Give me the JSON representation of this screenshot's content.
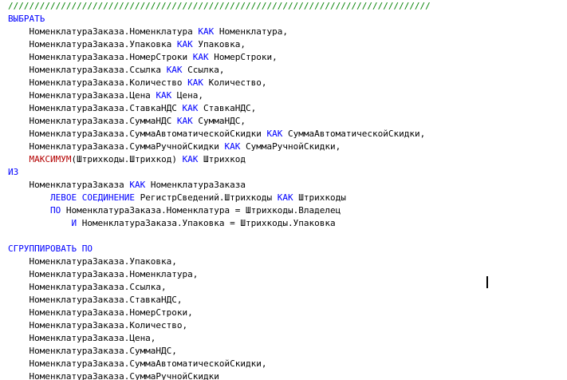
{
  "editor": {
    "colors": {
      "comment": "#008000",
      "keyword": "#0000ff",
      "function": "#b40000",
      "text": "#000000",
      "background": "#ffffff"
    },
    "lines": [
      [
        {
          "t": "////////////////////////////////////////////////////////////////////////////////",
          "c": "cm"
        }
      ],
      [
        {
          "t": "ВЫБРАТЬ",
          "c": "kw"
        }
      ],
      [
        {
          "t": "    НоменклатураЗаказа.Номенклатура ",
          "c": "id"
        },
        {
          "t": "КАК",
          "c": "kw"
        },
        {
          "t": " Номенклатура,",
          "c": "id"
        }
      ],
      [
        {
          "t": "    НоменклатураЗаказа.Упаковка ",
          "c": "id"
        },
        {
          "t": "КАК",
          "c": "kw"
        },
        {
          "t": " Упаковка,",
          "c": "id"
        }
      ],
      [
        {
          "t": "    НоменклатураЗаказа.НомерСтроки ",
          "c": "id"
        },
        {
          "t": "КАК",
          "c": "kw"
        },
        {
          "t": " НомерСтроки,",
          "c": "id"
        }
      ],
      [
        {
          "t": "    НоменклатураЗаказа.Ссылка ",
          "c": "id"
        },
        {
          "t": "КАК",
          "c": "kw"
        },
        {
          "t": " Ссылка,",
          "c": "id"
        }
      ],
      [
        {
          "t": "    НоменклатураЗаказа.Количество ",
          "c": "id"
        },
        {
          "t": "КАК",
          "c": "kw"
        },
        {
          "t": " Количество,",
          "c": "id"
        }
      ],
      [
        {
          "t": "    НоменклатураЗаказа.Цена ",
          "c": "id"
        },
        {
          "t": "КАК",
          "c": "kw"
        },
        {
          "t": " Цена,",
          "c": "id"
        }
      ],
      [
        {
          "t": "    НоменклатураЗаказа.СтавкаНДС ",
          "c": "id"
        },
        {
          "t": "КАК",
          "c": "kw"
        },
        {
          "t": " СтавкаНДС,",
          "c": "id"
        }
      ],
      [
        {
          "t": "    НоменклатураЗаказа.СуммаНДС ",
          "c": "id"
        },
        {
          "t": "КАК",
          "c": "kw"
        },
        {
          "t": " СуммаНДС,",
          "c": "id"
        }
      ],
      [
        {
          "t": "    НоменклатураЗаказа.СуммаАвтоматическойСкидки ",
          "c": "id"
        },
        {
          "t": "КАК",
          "c": "kw"
        },
        {
          "t": " СуммаАвтоматическойСкидки,",
          "c": "id"
        }
      ],
      [
        {
          "t": "    НоменклатураЗаказа.СуммаРучнойСкидки ",
          "c": "id"
        },
        {
          "t": "КАК",
          "c": "kw"
        },
        {
          "t": " СуммаРучнойСкидки,",
          "c": "id"
        }
      ],
      [
        {
          "t": "    ",
          "c": "id"
        },
        {
          "t": "МАКСИМУМ",
          "c": "fn"
        },
        {
          "t": "(Штрихкоды.Штрихкод) ",
          "c": "id"
        },
        {
          "t": "КАК",
          "c": "kw"
        },
        {
          "t": " Штрихкод",
          "c": "id"
        }
      ],
      [
        {
          "t": "ИЗ",
          "c": "kw"
        }
      ],
      [
        {
          "t": "    НоменклатураЗаказа ",
          "c": "id"
        },
        {
          "t": "КАК",
          "c": "kw"
        },
        {
          "t": " НоменклатураЗаказа",
          "c": "id"
        }
      ],
      [
        {
          "t": "        ",
          "c": "id"
        },
        {
          "t": "ЛЕВОЕ СОЕДИНЕНИЕ",
          "c": "kw"
        },
        {
          "t": " РегистрСведений.Штрихкоды ",
          "c": "id"
        },
        {
          "t": "КАК",
          "c": "kw"
        },
        {
          "t": " Штрихкоды",
          "c": "id"
        }
      ],
      [
        {
          "t": "        ",
          "c": "id"
        },
        {
          "t": "ПО",
          "c": "kw"
        },
        {
          "t": " НоменклатураЗаказа.Номенклатура = Штрихкоды.Владелец",
          "c": "id"
        }
      ],
      [
        {
          "t": "            ",
          "c": "id"
        },
        {
          "t": "И",
          "c": "kw"
        },
        {
          "t": " НоменклатураЗаказа.Упаковка = Штрихкоды.Упаковка",
          "c": "id"
        }
      ],
      [
        {
          "t": "",
          "c": "id"
        }
      ],
      [
        {
          "t": "СГРУППИРОВАТЬ ПО",
          "c": "kw"
        }
      ],
      [
        {
          "t": "    НоменклатураЗаказа.Упаковка,",
          "c": "id"
        }
      ],
      [
        {
          "t": "    НоменклатураЗаказа.Номенклатура,",
          "c": "id"
        }
      ],
      [
        {
          "t": "    НоменклатураЗаказа.Ссылка,",
          "c": "id"
        }
      ],
      [
        {
          "t": "    НоменклатураЗаказа.СтавкаНДС,",
          "c": "id"
        }
      ],
      [
        {
          "t": "    НоменклатураЗаказа.НомерСтроки,",
          "c": "id"
        }
      ],
      [
        {
          "t": "    НоменклатураЗаказа.Количество,",
          "c": "id"
        }
      ],
      [
        {
          "t": "    НоменклатураЗаказа.Цена,",
          "c": "id"
        }
      ],
      [
        {
          "t": "    НоменклатураЗаказа.СуммаНДС,",
          "c": "id"
        }
      ],
      [
        {
          "t": "    НоменклатураЗаказа.СуммаАвтоматическойСкидки,",
          "c": "id"
        }
      ],
      [
        {
          "t": "    НоменклатураЗаказа.СуммаРучнойСкидки",
          "c": "id"
        }
      ]
    ]
  }
}
